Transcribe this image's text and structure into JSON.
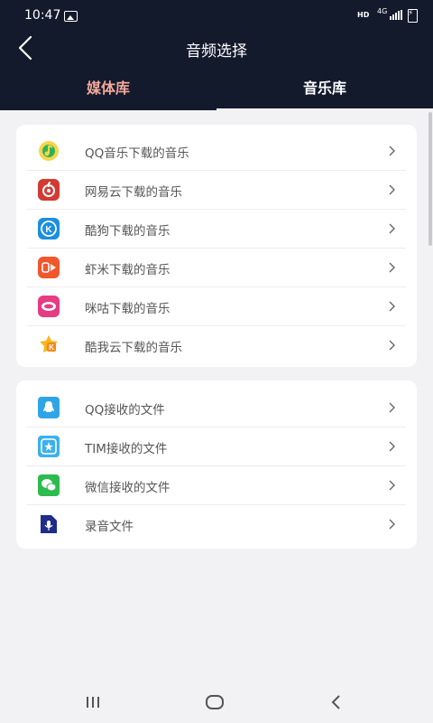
{
  "status_bar": {
    "time": "10:47",
    "network_label": "HD",
    "network_type": "4G"
  },
  "header": {
    "title": "音频选择"
  },
  "tabs": [
    {
      "label": "媒体库",
      "active": true
    },
    {
      "label": "音乐库",
      "active": false
    }
  ],
  "colors": {
    "header_bg": "#121a2c",
    "active_tab": "#f3a99c",
    "page_bg": "#f2f2f4"
  },
  "music_sources": [
    {
      "label": "QQ音乐下载的音乐",
      "icon": "qq-music-icon"
    },
    {
      "label": "网易云下载的音乐",
      "icon": "netease-cloud-music-icon"
    },
    {
      "label": "酷狗下载的音乐",
      "icon": "kugou-icon"
    },
    {
      "label": "虾米下载的音乐",
      "icon": "xiami-icon"
    },
    {
      "label": "咪咕下载的音乐",
      "icon": "migu-icon"
    },
    {
      "label": "酷我云下载的音乐",
      "icon": "kuwo-icon"
    }
  ],
  "file_sources": [
    {
      "label": "QQ接收的文件",
      "icon": "qq-icon"
    },
    {
      "label": "TIM接收的文件",
      "icon": "tim-icon"
    },
    {
      "label": "微信接收的文件",
      "icon": "wechat-icon"
    },
    {
      "label": "录音文件",
      "icon": "recorder-icon"
    }
  ]
}
